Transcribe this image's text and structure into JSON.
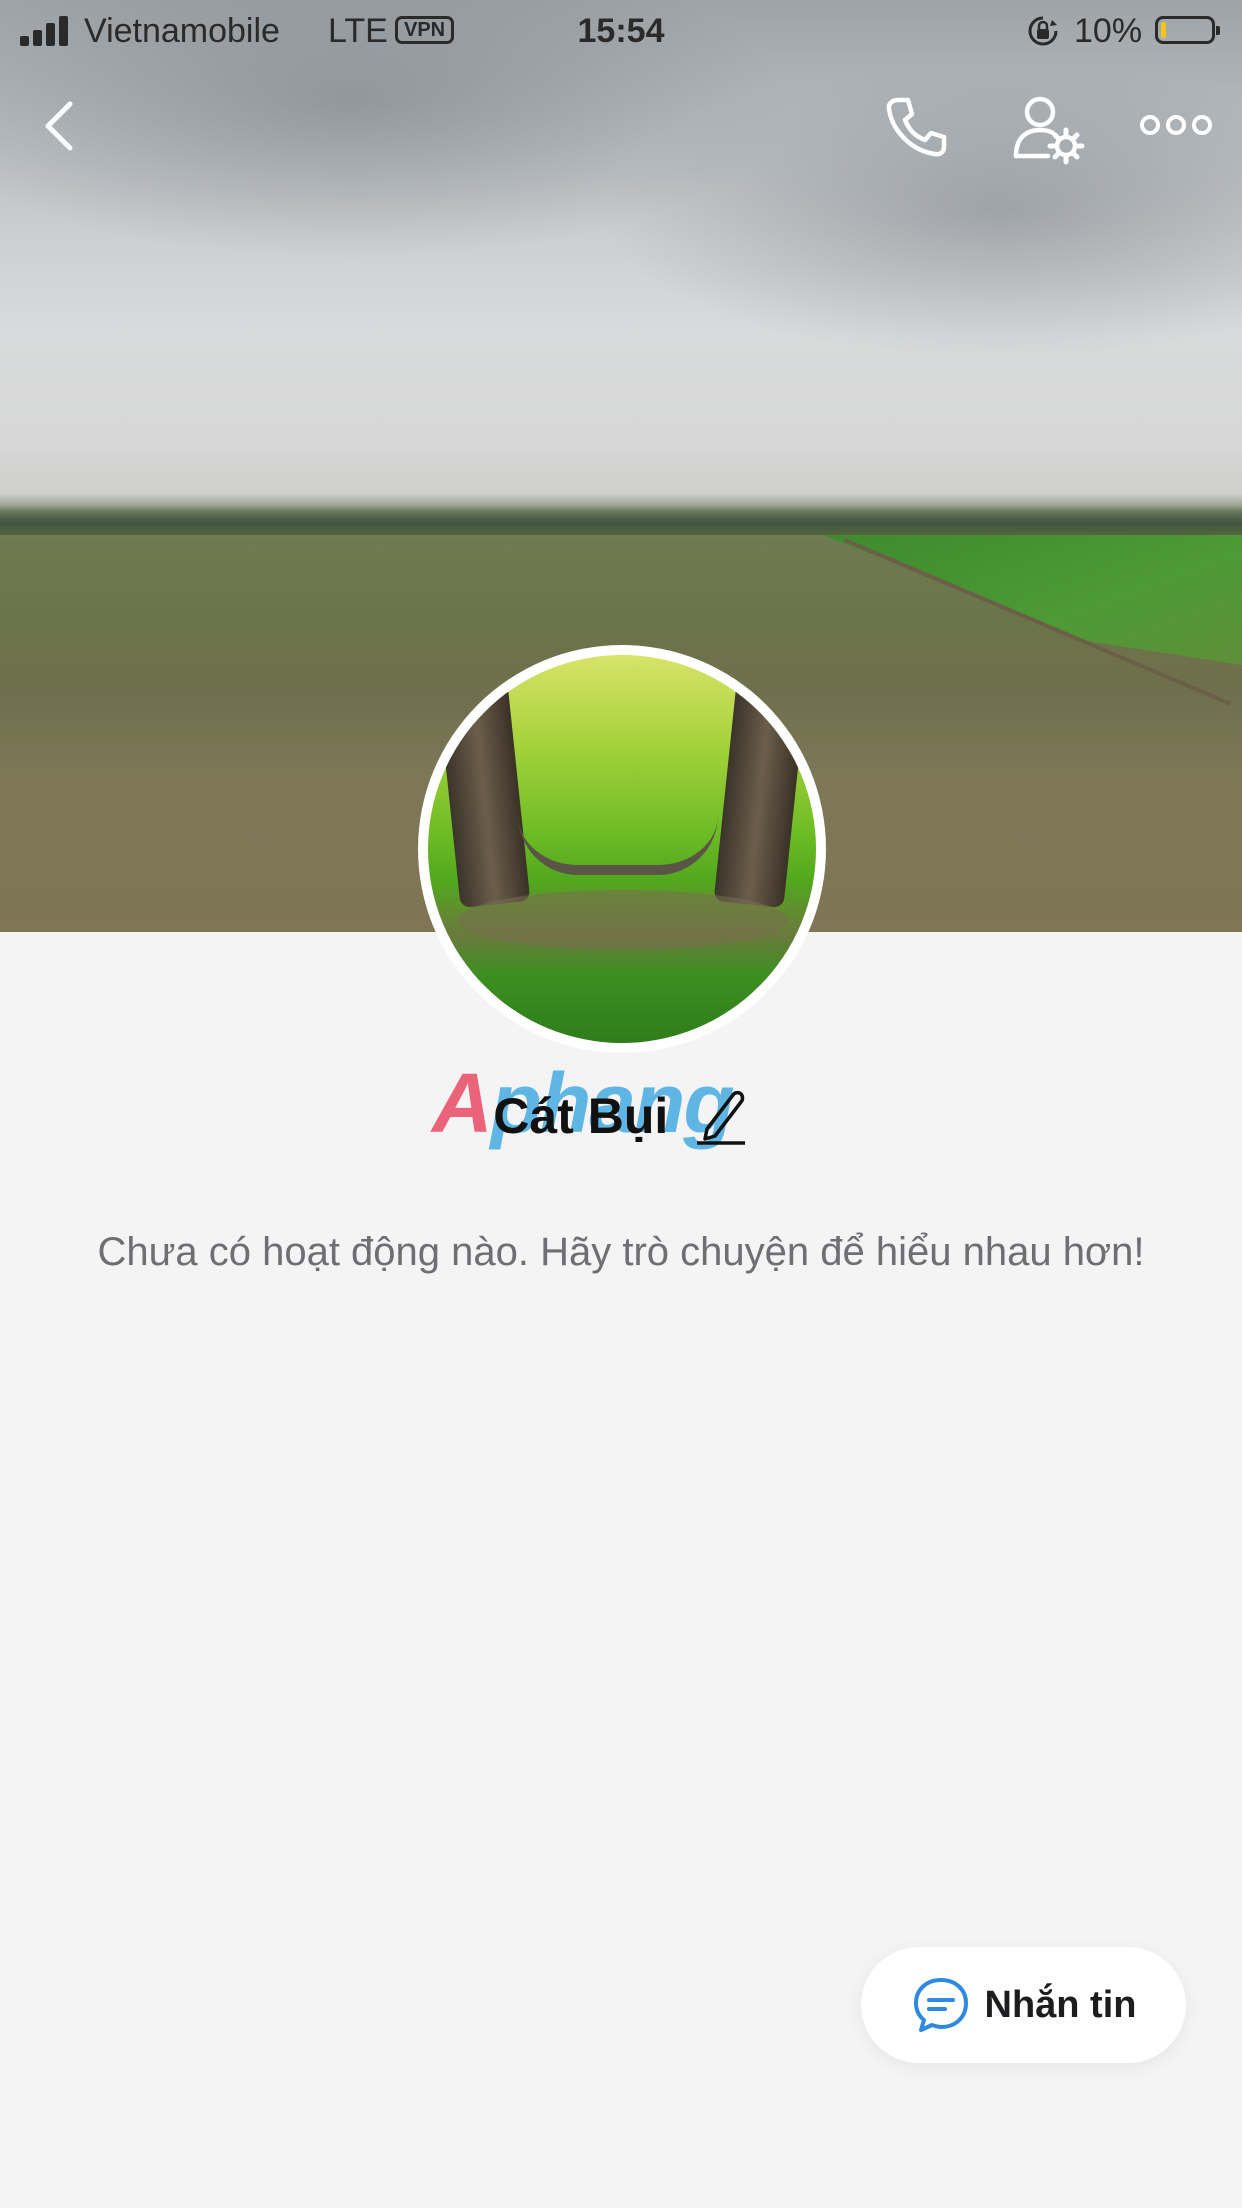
{
  "status_bar": {
    "carrier": "Vietnamobile",
    "network": "LTE",
    "vpn": "VPN",
    "time": "15:54",
    "battery_percent": "10%",
    "battery_level": 0.1,
    "battery_color": "#f5c518"
  },
  "header": {
    "back_icon": "chevron-left-icon",
    "call_icon": "phone-icon",
    "settings_icon": "user-settings-icon",
    "more_icon": "more-horizontal-icon"
  },
  "profile": {
    "name": "Cát Bụi",
    "edit_icon": "pencil-icon",
    "watermark": {
      "part1": "A",
      "part2": "phang"
    }
  },
  "activity": {
    "empty_message": "Chưa có hoạt động nào. Hãy trò chuyện để hiểu nhau hơn!"
  },
  "actions": {
    "message_label": "Nhắn tin",
    "message_icon": "chat-bubble-icon",
    "accent": "#2d8ae0"
  }
}
